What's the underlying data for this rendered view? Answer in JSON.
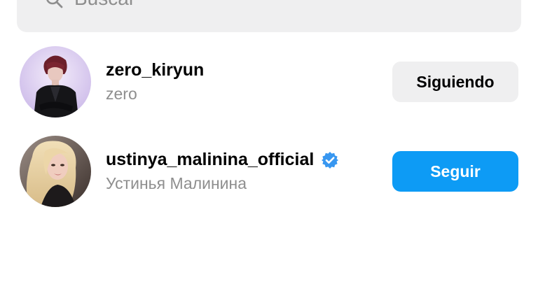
{
  "search": {
    "placeholder": "Buscar",
    "value": "",
    "icon": "search-icon"
  },
  "results": [
    {
      "username": "zero_kiryun",
      "full_name": "zero",
      "verified": false,
      "button_label": "Siguiendo",
      "button_state": "following",
      "button_color": "#efeff0"
    },
    {
      "username": "ustinya_malinina_official",
      "full_name": "Устинья Малинина",
      "verified": true,
      "button_label": "Seguir",
      "button_state": "follow",
      "button_color": "#0d9bf5"
    }
  ],
  "colors": {
    "verified_badge": "#3897f0",
    "follow_button": "#0d9bf5",
    "secondary_text": "#8e8e8e",
    "search_background": "#efeff0"
  }
}
